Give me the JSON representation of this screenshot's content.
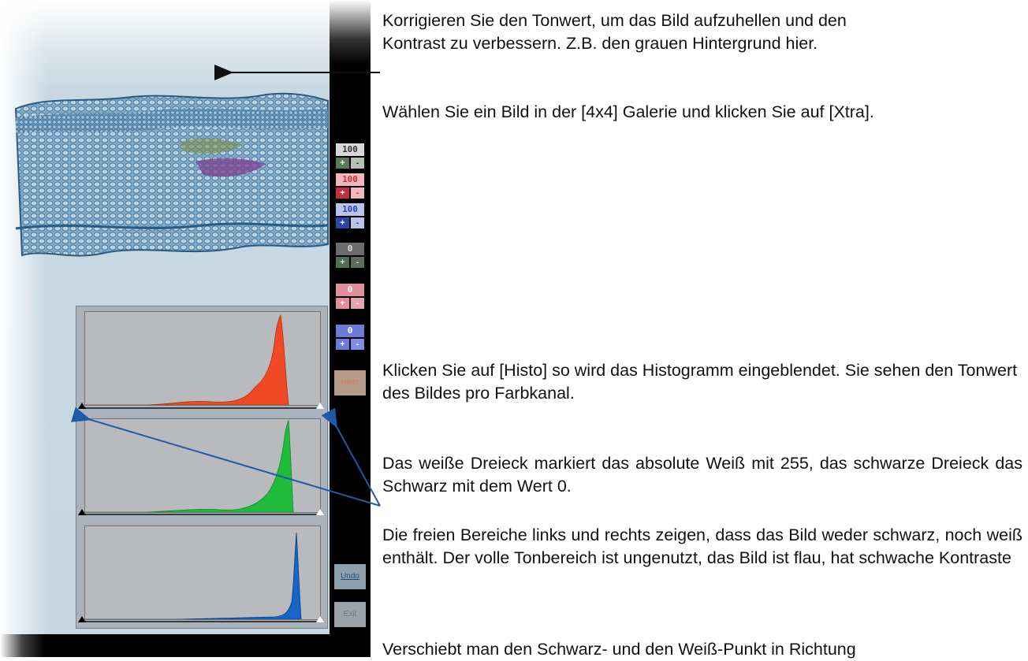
{
  "app": {
    "controls": [
      {
        "value": "100",
        "plus": "+",
        "minus": "-",
        "color": "#ffffff",
        "bg": "#d8d8d8",
        "btn_color": "#5a7a5a"
      },
      {
        "value": "100",
        "plus": "+",
        "minus": "-",
        "color": "#c0303a",
        "bg": "#f2b6bd",
        "btn_color": "#c0303a"
      },
      {
        "value": "100",
        "plus": "+",
        "minus": "-",
        "color": "#2c46a8",
        "bg": "#b9c3ec",
        "btn_color": "#2c46a8"
      },
      {
        "value": "0",
        "plus": "+",
        "minus": "-",
        "color": "#ffffff",
        "bg": "#6c6c6c",
        "btn_color": "#4f7050"
      },
      {
        "value": "0",
        "plus": "+",
        "minus": "-",
        "color": "#ffffff",
        "bg": "#e28f9a",
        "btn_color": "#e28f9a"
      },
      {
        "value": "0",
        "plus": "+",
        "minus": "-",
        "color": "#ffffff",
        "bg": "#6a7bd6",
        "btn_color": "#6a7bd6"
      }
    ],
    "buttons": {
      "histo": "Histo",
      "undo": "Undo",
      "exit": "Exit"
    },
    "histograms": [
      {
        "channel": "red",
        "color": "#ef4a25"
      },
      {
        "channel": "green",
        "color": "#1fbc3c"
      },
      {
        "channel": "blue",
        "color": "#1466c8"
      }
    ]
  },
  "annotations": {
    "p1": "Korrigieren Sie den Tonwert, um das Bild aufzuhellen und den Kontrast zu verbessern. Z.B. den grauen Hintergrund hier.",
    "p2": "Wählen Sie ein Bild in der [4x4] Galerie und klicken Sie auf [Xtra].",
    "p3": "Klicken Sie auf [Histo] so wird das Histogramm eingeblendet. Sie sehen den Tonwert des Bildes pro Farbkanal.",
    "p4": "Das weiße Dreieck markiert das absolute Weiß mit 255, das schwarze Dreieck das Schwarz mit dem Wert 0.",
    "p5": "Die freien Bereiche links und rechts zeigen, dass das Bild weder schwarz, noch weiß enthält. Der volle Tonbereich ist ungenutzt, das Bild ist flau, hat schwache Kontraste",
    "p6": "Verschiebt man den Schwarz- und den Weiß-Punkt in Richtung"
  },
  "colors": {
    "arrow_black": "#111111",
    "arrow_blue": "#1f5aa8"
  }
}
